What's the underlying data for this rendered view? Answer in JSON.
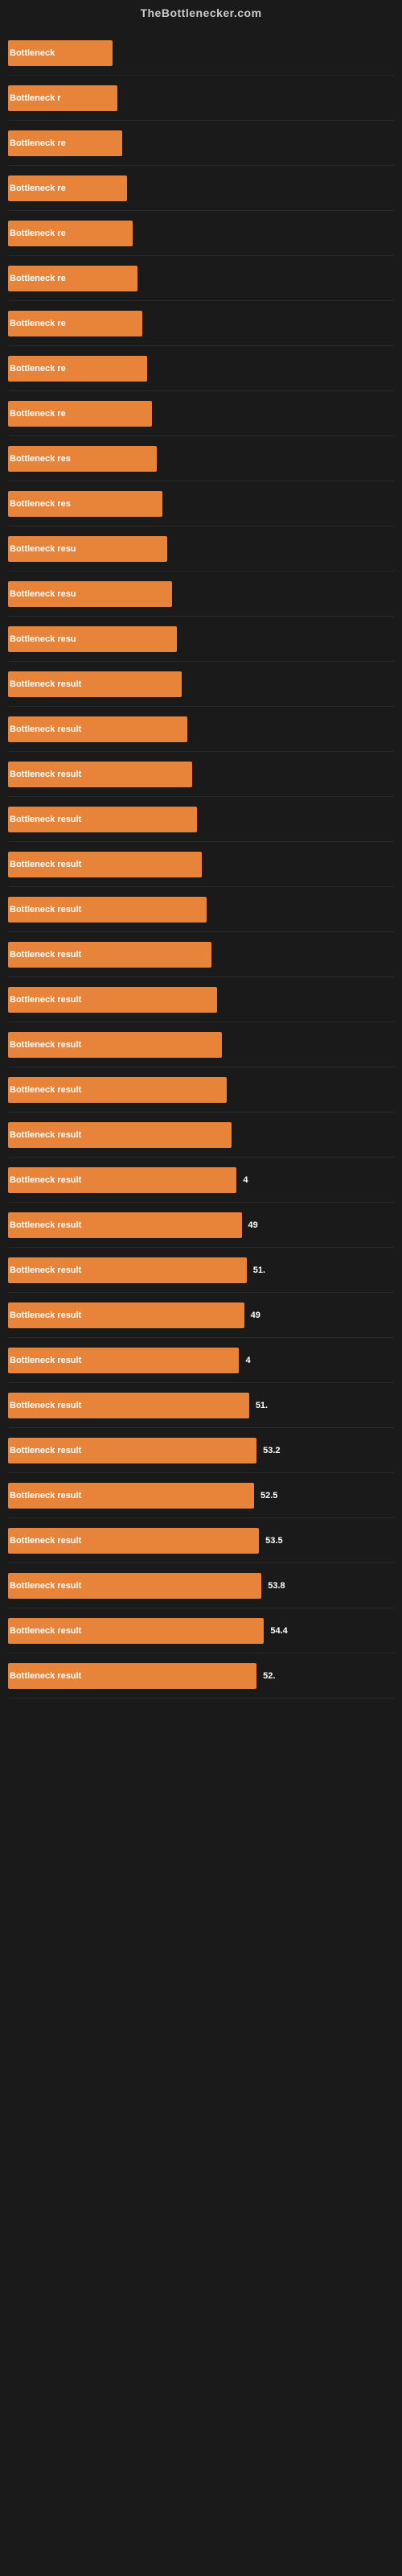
{
  "header": {
    "title": "TheBottlenecker.com"
  },
  "bars": [
    {
      "label": "Bottleneck",
      "width": 42,
      "value": null
    },
    {
      "label": "Bottleneck r",
      "width": 44,
      "value": null
    },
    {
      "label": "Bottleneck re",
      "width": 46,
      "value": null
    },
    {
      "label": "Bottleneck re",
      "width": 48,
      "value": null
    },
    {
      "label": "Bottleneck re",
      "width": 50,
      "value": null
    },
    {
      "label": "Bottleneck re",
      "width": 52,
      "value": null
    },
    {
      "label": "Bottleneck re",
      "width": 54,
      "value": null
    },
    {
      "label": "Bottleneck re",
      "width": 56,
      "value": null
    },
    {
      "label": "Bottleneck re",
      "width": 58,
      "value": null
    },
    {
      "label": "Bottleneck res",
      "width": 60,
      "value": null
    },
    {
      "label": "Bottleneck res",
      "width": 62,
      "value": null
    },
    {
      "label": "Bottleneck resu",
      "width": 64,
      "value": null
    },
    {
      "label": "Bottleneck resu",
      "width": 66,
      "value": null
    },
    {
      "label": "Bottleneck resu",
      "width": 68,
      "value": null
    },
    {
      "label": "Bottleneck result",
      "width": 70,
      "value": null
    },
    {
      "label": "Bottleneck result",
      "width": 72,
      "value": null
    },
    {
      "label": "Bottleneck result",
      "width": 74,
      "value": null
    },
    {
      "label": "Bottleneck result",
      "width": 76,
      "value": null
    },
    {
      "label": "Bottleneck result",
      "width": 78,
      "value": null
    },
    {
      "label": "Bottleneck result",
      "width": 80,
      "value": null
    },
    {
      "label": "Bottleneck result",
      "width": 82,
      "value": null
    },
    {
      "label": "Bottleneck result",
      "width": 84,
      "value": null
    },
    {
      "label": "Bottleneck result",
      "width": 86,
      "value": null
    },
    {
      "label": "Bottleneck result",
      "width": 88,
      "value": null
    },
    {
      "label": "Bottleneck result",
      "width": 90,
      "value": null
    },
    {
      "label": "Bottleneck result",
      "width": 92,
      "value": "4"
    },
    {
      "label": "Bottleneck result",
      "width": 94,
      "value": "49"
    },
    {
      "label": "Bottleneck result",
      "width": 96,
      "value": "51."
    },
    {
      "label": "Bottleneck result",
      "width": 95,
      "value": "49"
    },
    {
      "label": "Bottleneck result",
      "width": 93,
      "value": "4"
    },
    {
      "label": "Bottleneck result",
      "width": 97,
      "value": "51."
    },
    {
      "label": "Bottleneck result",
      "width": 100,
      "value": "53.2"
    },
    {
      "label": "Bottleneck result",
      "width": 99,
      "value": "52.5"
    },
    {
      "label": "Bottleneck result",
      "width": 101,
      "value": "53.5"
    },
    {
      "label": "Bottleneck result",
      "width": 102,
      "value": "53.8"
    },
    {
      "label": "Bottleneck result",
      "width": 103,
      "value": "54.4"
    },
    {
      "label": "Bottleneck result",
      "width": 100,
      "value": "52."
    }
  ]
}
